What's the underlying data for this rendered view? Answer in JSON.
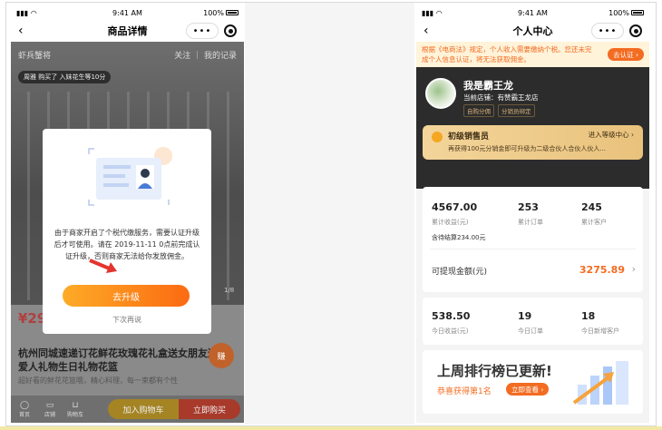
{
  "left": {
    "status": {
      "time": "9:41 AM",
      "battery": "100%"
    },
    "nav": {
      "title": "商品详情"
    },
    "shop": {
      "name": "虾兵蟹将",
      "follow": "关注",
      "records": "我的记录"
    },
    "tip": "周雅 购买了 入妹花生等10分",
    "price": "¥29",
    "product_title": "杭州同城速递订花鲜花玫瑰花礼盒送女朋友送爱人礼物生日礼物花篮",
    "product_desc": "超好看的鲜花花篮哦，精心料理，每一束都有个性",
    "page_indicator": "1/8",
    "circle_badge": "赚",
    "tabbar": {
      "home": "首页",
      "shop": "店铺",
      "cart": "购物车",
      "add_cart": "加入购物车",
      "buy_now": "立即购买"
    },
    "modal": {
      "text": "由于商家开启了个税代缴服务，需要认证升级后才可使用。请在 2019-11-11 0点前完成认证升级，否则商家无法给你发放佣金。",
      "upgrade": "去升级",
      "later": "下次再说"
    }
  },
  "right": {
    "status": {
      "time": "9:41 AM",
      "battery": "100%"
    },
    "nav": {
      "title": "个人中心"
    },
    "notice": {
      "text": "根据《电商法》规定，个人收入需要缴纳个税。您还未完成个人信息认证，将无法获取佣金。",
      "button": "去认证 ›"
    },
    "user": {
      "name": "我是霸王龙",
      "shop": "当前店铺：有赞霸王龙店",
      "tag1": "自购分佣",
      "tag2": "分销员绑定"
    },
    "level": {
      "name": "初级销售员",
      "link": "进入等级中心 ›",
      "desc": "再获得100元分销金即可升级为二级合伙人合伙人伙人..."
    },
    "stats": {
      "income": "4567.00",
      "income_label": "累计收益(元)",
      "orders": "253",
      "orders_label": "累计订单",
      "customers": "245",
      "customers_label": "累计客户",
      "settled": "含待结算234.00元",
      "withdraw_label": "可提现金额(元)",
      "withdraw": "3275.89",
      "today_income": "538.50",
      "today_income_label": "今日收益(元)",
      "today_orders": "19",
      "today_orders_label": "今日订单",
      "today_customers": "18",
      "today_customers_label": "今日新增客户"
    },
    "rank": {
      "title": "上周排行榜已更新!",
      "sub": "恭喜获得第1名",
      "button": "立即查看 ›"
    }
  }
}
